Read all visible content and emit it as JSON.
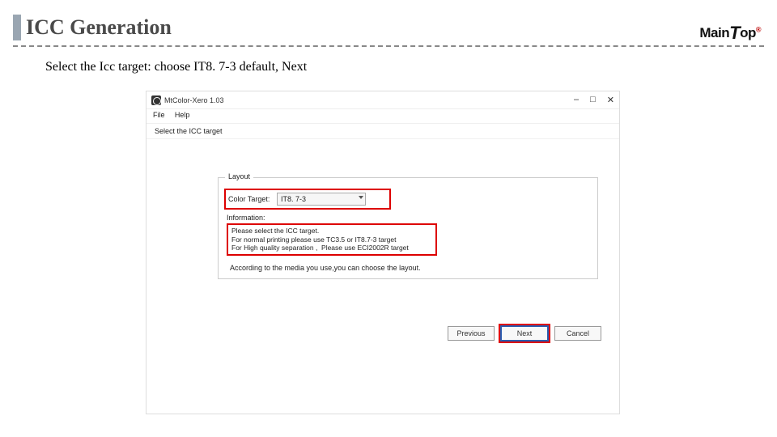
{
  "slide": {
    "title": "ICC Generation",
    "instruction": "Select the Icc target: choose  IT8. 7-3 default, Next"
  },
  "logo": {
    "part1": "Main",
    "part2": "T",
    "part3": "op"
  },
  "app": {
    "title": "MtColor-Xero 1.03",
    "menu": {
      "file": "File",
      "help": "Help"
    },
    "subtitle": "Select the ICC target",
    "panel_label": "Layout",
    "color_target_label": "Color Target:",
    "color_target_value": "IT8. 7-3",
    "info_title": "Information:",
    "info_line1": "Please select the ICC target.",
    "info_line2": "For normal printing please use TC3.5 or IT8.7-3 target",
    "info_line3": "For High quality separation ,  Please use ECI2002R target",
    "note": "According to the media you use,you can choose the layout.",
    "buttons": {
      "previous": "Previous",
      "next": "Next",
      "cancel": "Cancel"
    },
    "win": {
      "min": "–",
      "max": "□",
      "close": "✕"
    }
  }
}
